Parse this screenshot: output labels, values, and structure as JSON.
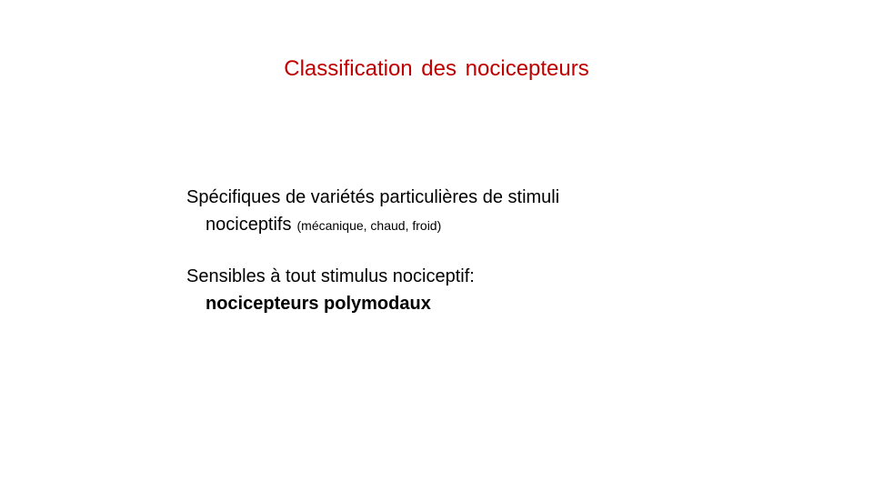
{
  "slide": {
    "title": "Classification des nocicepteurs",
    "title_color": "#c00000",
    "items": [
      {
        "line1": "Spécifiques de variétés particulières de stimuli",
        "line2": "nociceptifs",
        "note": "(mécanique, chaud, froid)"
      },
      {
        "line1": "Sensibles à tout stimulus nociceptif:",
        "line2": "nocicepteurs polymodaux"
      }
    ]
  }
}
